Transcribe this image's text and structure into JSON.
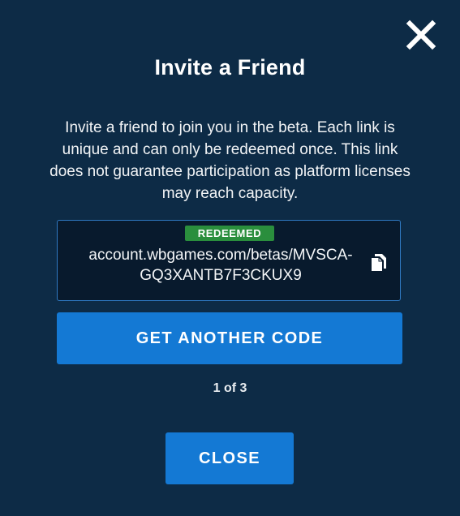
{
  "modal": {
    "title": "Invite a Friend",
    "description": "Invite a friend to join you in the beta. Each link is unique and can only be redeemed once. This link does not guarantee participation as platform licenses may reach capacity.",
    "close_icon": "close-x-icon"
  },
  "invite": {
    "status_badge": "REDEEMED",
    "link_line1": "account.wbgames.com/betas/MVSCA-",
    "link_line2": "GQ3XANTB7F3CKUX9",
    "copy_icon": "copy-icon"
  },
  "actions": {
    "get_another_label": "GET ANOTHER CODE",
    "close_label": "CLOSE"
  },
  "pagination": {
    "label": "1 of 3"
  },
  "colors": {
    "background": "#0d2b46",
    "link_box": "#081a2d",
    "link_border": "#2f79c2",
    "badge": "#2a8e3d",
    "button": "#1479d4"
  }
}
